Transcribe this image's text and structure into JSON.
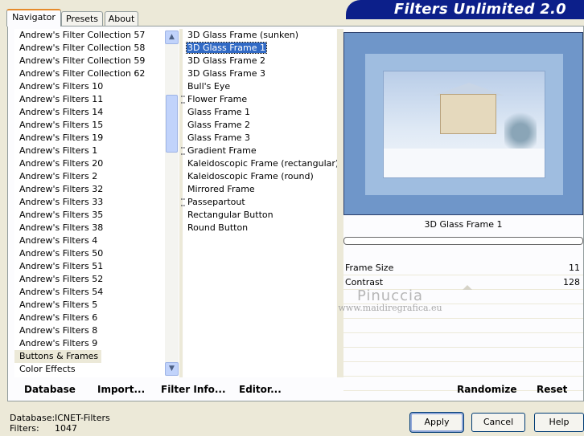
{
  "header": {
    "tabs": [
      {
        "label": "Navigator",
        "active": true
      },
      {
        "label": "Presets",
        "active": false
      },
      {
        "label": "About",
        "active": false
      }
    ],
    "title": "Filters Unlimited 2.0"
  },
  "categories": {
    "items": [
      "Andrew's Filter Collection 57",
      "Andrew's Filter Collection 58",
      "Andrew's Filter Collection 59",
      "Andrew's Filter Collection 62",
      "Andrew's Filters 10",
      "Andrew's Filters 11",
      "Andrew's Filters 14",
      "Andrew's Filters 15",
      "Andrew's Filters 19",
      "Andrew's Filters 1",
      "Andrew's Filters 20",
      "Andrew's Filters 2",
      "Andrew's Filters 32",
      "Andrew's Filters 33",
      "Andrew's Filters 35",
      "Andrew's Filters 38",
      "Andrew's Filters 4",
      "Andrew's Filters 50",
      "Andrew's Filters 51",
      "Andrew's Filters 52",
      "Andrew's Filters 54",
      "Andrew's Filters 5",
      "Andrew's Filters 6",
      "Andrew's Filters 8",
      "Andrew's Filters 9",
      "Buttons & Frames",
      "Color Effects"
    ],
    "selected": "Buttons & Frames"
  },
  "filters": {
    "items": [
      {
        "label": "3D Glass Frame (sunken)",
        "marked": false
      },
      {
        "label": "3D Glass Frame 1",
        "marked": false
      },
      {
        "label": "3D Glass Frame 2",
        "marked": false
      },
      {
        "label": "3D Glass Frame 3",
        "marked": false
      },
      {
        "label": "Bull's Eye",
        "marked": false
      },
      {
        "label": "Flower Frame",
        "marked": true
      },
      {
        "label": "Glass Frame 1",
        "marked": false
      },
      {
        "label": "Glass Frame 2",
        "marked": false
      },
      {
        "label": "Glass Frame 3",
        "marked": false
      },
      {
        "label": "Gradient Frame",
        "marked": true
      },
      {
        "label": "Kaleidoscopic Frame (rectangular)",
        "marked": false
      },
      {
        "label": "Kaleidoscopic Frame (round)",
        "marked": false
      },
      {
        "label": "Mirrored Frame",
        "marked": false
      },
      {
        "label": "Passepartout",
        "marked": true
      },
      {
        "label": "Rectangular Button",
        "marked": false
      },
      {
        "label": "Round Button",
        "marked": false
      }
    ],
    "selected": "3D Glass Frame 1"
  },
  "preview": {
    "filter_name": "3D Glass Frame 1"
  },
  "params": [
    {
      "label": "Frame Size",
      "value": "11"
    },
    {
      "label": "Contrast",
      "value": "128"
    }
  ],
  "watermark": {
    "line1": "Pinuccia",
    "line2": "www.maidiregrafica.eu"
  },
  "bottom": {
    "database": "Database",
    "import": "Import...",
    "filter_info": "Filter Info...",
    "editor": "Editor...",
    "randomize": "Randomize",
    "reset": "Reset"
  },
  "status": {
    "database_label": "Database:",
    "database_value": "ICNET-Filters",
    "filters_label": "Filters:",
    "filters_value": "1047"
  },
  "buttons": {
    "apply": "Apply",
    "cancel": "Cancel",
    "help": "Help"
  },
  "colors": {
    "title_banner": "#0c1f8a",
    "selection": "#316ac5",
    "tab_active_border": "#e68b2c"
  }
}
